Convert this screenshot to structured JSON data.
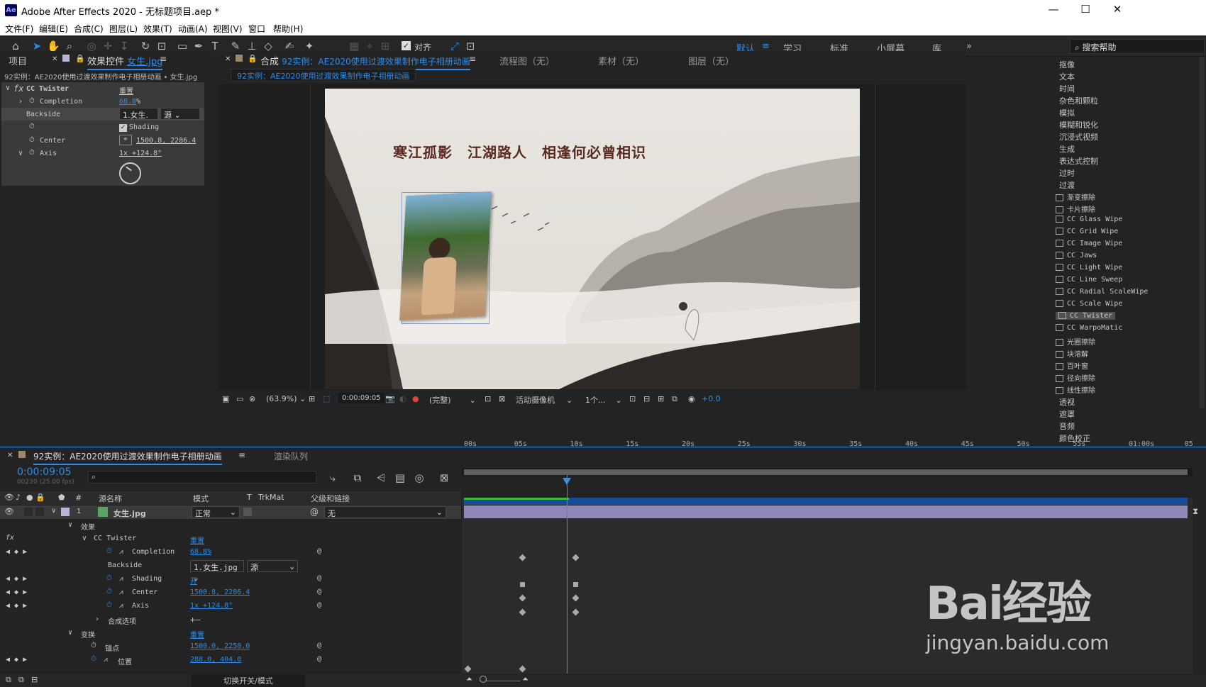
{
  "window": {
    "title": "Adobe After Effects 2020 - 无标题项目.aep *",
    "app_icon": "Ae",
    "min": "—",
    "max": "☐",
    "close": "✕"
  },
  "menu": [
    "文件(F)",
    "编辑(E)",
    "合成(C)",
    "图层(L)",
    "效果(T)",
    "动画(A)",
    "视图(V)",
    "窗口",
    "帮助(H)"
  ],
  "toolbar": {
    "align_label": "对齐",
    "workspaces": [
      "默认",
      "学习",
      "标准",
      "小屏幕",
      "库"
    ],
    "search_placeholder": "搜索帮助",
    "more": "»"
  },
  "effect_panel": {
    "tab_project": "项目",
    "tab_effects": "效果控件",
    "tab_layer": "女生.jpg",
    "breadcrumb": "92实例：AE2020使用过渡效果制作电子相册动画 • 女生.jpg",
    "effect_name": "CC Twister",
    "reset": "重置",
    "completion_label": "Completion",
    "completion_value": "68.8",
    "completion_unit": "%",
    "backside_label": "Backside",
    "backside_layer": "1.女生.",
    "backside_source": "源",
    "shading_label": "Shading",
    "center_label": "Center",
    "center_value": "1500.8, 2286.4",
    "axis_label": "Axis",
    "axis_value": "1x +124.8°"
  },
  "comp_panel": {
    "tab_label": "合成",
    "comp_name": "92实例：AE2020使用过渡效果制作电子相册动画",
    "flowchart": "流程图（无）",
    "footage": "素材（无）",
    "layer": "图层（无）",
    "sub_tab": "92实例：AE2020使用过渡效果制作电子相册动画",
    "poem": "寒江孤影　江湖路人　相逢何必曾相识",
    "zoom": "(63.9%)",
    "timecode": "0:00:09:05",
    "resolution": "(完整)",
    "camera": "活动摄像机",
    "views": "1个...",
    "exposure": "+0.0"
  },
  "effects_presets": {
    "categories_top": [
      "抠像",
      "文本",
      "时间",
      "杂色和颗粒",
      "模拟",
      "模糊和锐化",
      "沉浸式视频",
      "生成",
      "表达式控制",
      "过时",
      "过渡"
    ],
    "transitions": [
      "渐变擦除",
      "卡片擦除",
      "CC Glass Wipe",
      "CC Grid Wipe",
      "CC Image Wipe",
      "CC Jaws",
      "CC Light Wipe",
      "CC Line Sweep",
      "CC Radial ScaleWipe",
      "CC Scale Wipe",
      "CC Twister",
      "CC WarpoMatic",
      "光圈擦除",
      "块溶解",
      "百叶窗",
      "径向擦除",
      "线性擦除"
    ],
    "selected": "CC Twister",
    "categories_bottom": [
      "透视",
      "遮罩",
      "音频",
      "颜色校正"
    ]
  },
  "timeline": {
    "tab_comp": "92实例：AE2020使用过渡效果制作电子相册动画",
    "tab_render": "渲染队列",
    "timecode": "0:00:09:05",
    "frames": "00230 (25.00 fps)",
    "search_placeholder": "",
    "headers": {
      "num": "#",
      "source": "源名称",
      "mode": "模式",
      "t": "T",
      "trkmat": "TrkMat",
      "parent": "父级和链接"
    },
    "layer": {
      "num": "1",
      "name": "女生.jpg",
      "mode": "正常",
      "parent": "无"
    },
    "rows": {
      "effects": "效果",
      "twister": "CC Twister",
      "reset": "重置",
      "completion": "Completion",
      "completion_val": "68.8%",
      "backside": "Backside",
      "backside_layer": "1.女生.jpg",
      "backside_src": "源",
      "shading": "Shading",
      "shading_val": "开",
      "center": "Center",
      "center_val": "1500.8, 2286.4",
      "axis": "Axis",
      "axis_val": "1x +124.8°",
      "composite": "合成选项",
      "composite_val": "+—",
      "transform": "变换",
      "transform_reset": "重置",
      "anchor": "锚点",
      "anchor_val": "1500.0, 2250.0",
      "position": "位置",
      "position_val": "288.0, 404.0"
    },
    "ruler": [
      "00s",
      "05s",
      "10s",
      "15s",
      "20s",
      "25s",
      "30s",
      "35s",
      "40s",
      "45s",
      "50s",
      "55s",
      "01:00s",
      "05"
    ],
    "current_time_s": 9.2,
    "footer_toggle": "切换开关/模式"
  },
  "watermark": {
    "brand": "Bai经验",
    "url": "jingyan.baidu.com"
  }
}
